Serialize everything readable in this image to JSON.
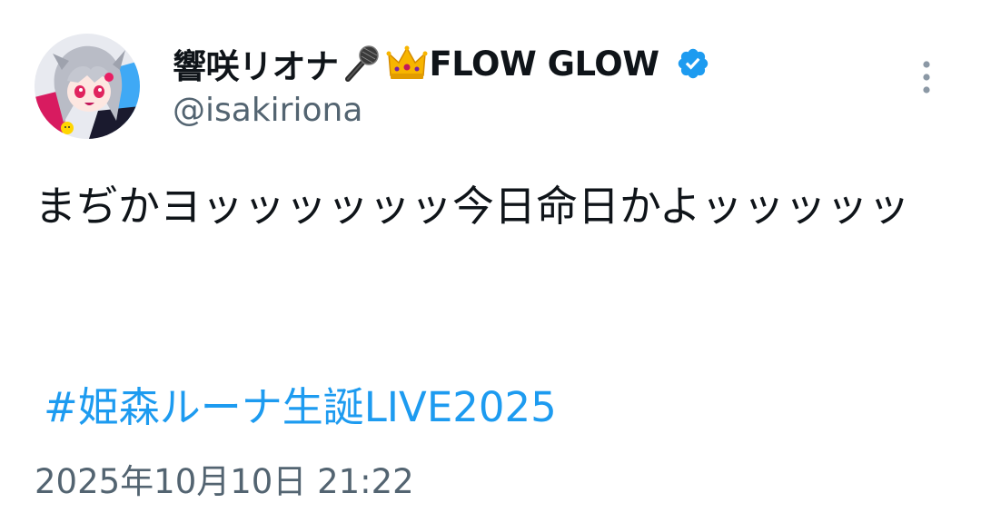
{
  "author": {
    "display_name": "響咲リオナ",
    "display_name_suffix": "FLOW GLOW",
    "emojis": [
      "microphone-emoji",
      "crown-emoji"
    ],
    "handle": "@isakiriona",
    "verified": true
  },
  "tweet": {
    "text": "まぢかヨッッッッッッ今日命日かよッッッッッ",
    "hashtag": "#姫森ルーナ生誕LIVE2025",
    "timestamp": "2025年10月10日 21:22"
  },
  "colors": {
    "text": "#0f1419",
    "secondary": "#536471",
    "link": "#1d9bf0",
    "verified": "#1d9bf0"
  },
  "icons": {
    "more": "more-vertical-icon",
    "verified": "verified-badge-icon"
  }
}
